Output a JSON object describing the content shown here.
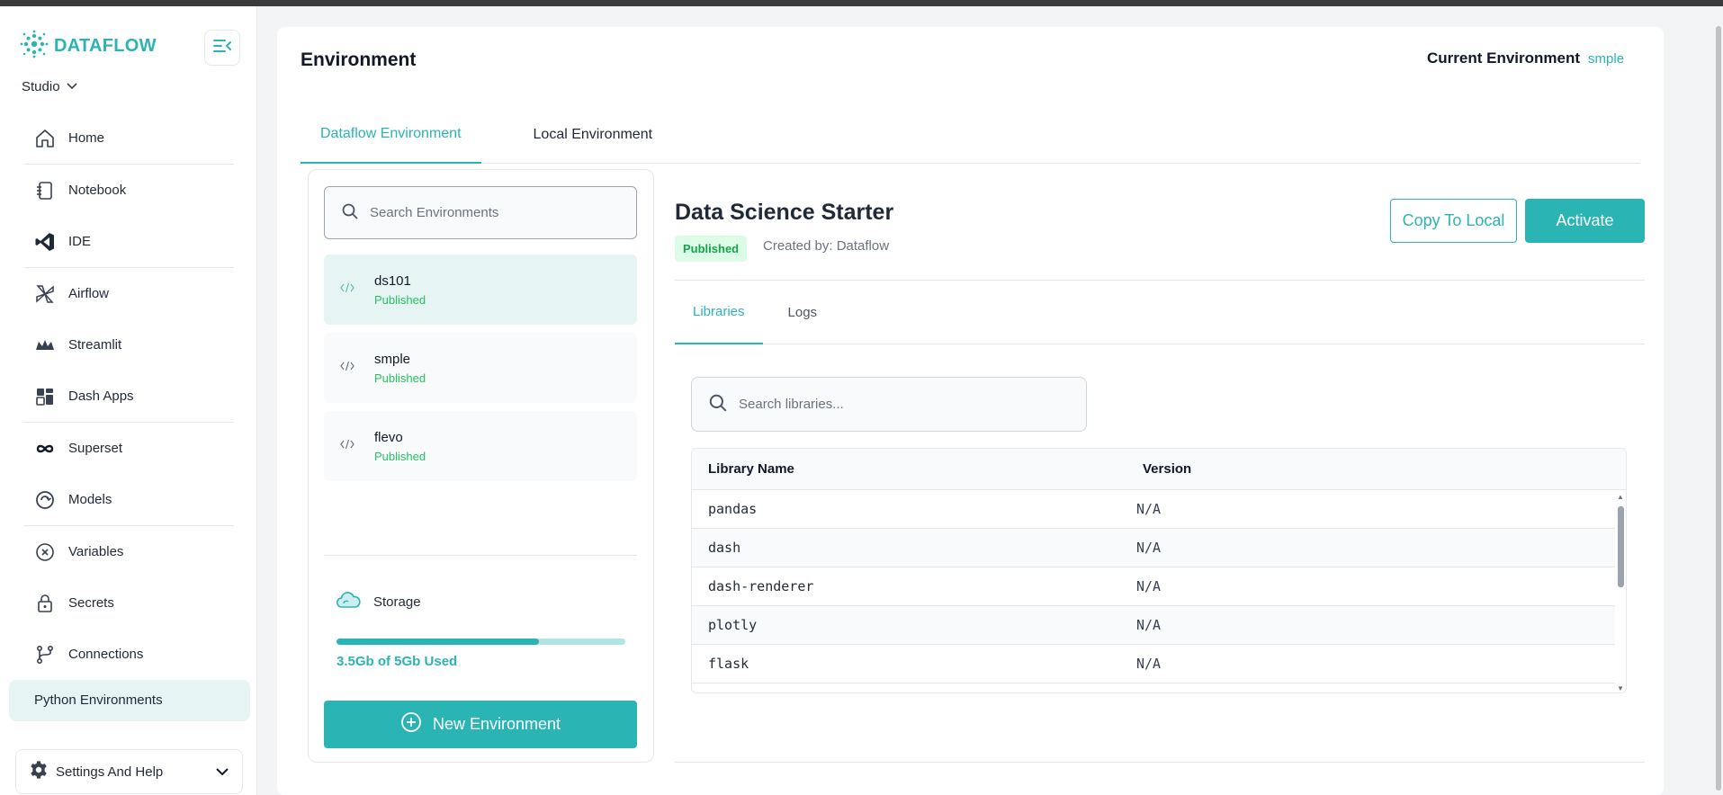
{
  "app": {
    "logo_text": "DATAFLOW",
    "workspace": "Studio"
  },
  "sidebar": {
    "items": [
      {
        "label": "Home",
        "icon": "home-icon"
      },
      {
        "label": "Notebook",
        "icon": "notebook-icon"
      },
      {
        "label": "IDE",
        "icon": "vscode-icon"
      },
      {
        "label": "Airflow",
        "icon": "airflow-icon"
      },
      {
        "label": "Streamlit",
        "icon": "streamlit-icon"
      },
      {
        "label": "Dash Apps",
        "icon": "dash-apps-icon"
      },
      {
        "label": "Superset",
        "icon": "infinity-icon"
      },
      {
        "label": "Models",
        "icon": "models-icon"
      },
      {
        "label": "Variables",
        "icon": "variables-icon"
      },
      {
        "label": "Secrets",
        "icon": "lock-icon"
      },
      {
        "label": "Connections",
        "icon": "connections-icon"
      },
      {
        "label": "Python Environments",
        "icon": "code-icon"
      }
    ],
    "settings_label": "Settings And Help"
  },
  "header": {
    "title": "Environment",
    "current_env_label": "Current Environment",
    "current_env_value": "smple"
  },
  "env_tabs": [
    {
      "label": "Dataflow Environment",
      "active": true
    },
    {
      "label": "Local Environment",
      "active": false
    }
  ],
  "env_panel": {
    "search_placeholder": "Search Environments",
    "environments": [
      {
        "name": "ds101",
        "status": "Published",
        "selected": true
      },
      {
        "name": "smple",
        "status": "Published",
        "selected": false
      },
      {
        "name": "flevo",
        "status": "Published",
        "selected": false
      }
    ],
    "storage_label": "Storage",
    "storage_used_text": "3.5Gb of 5Gb Used",
    "storage_fraction": 0.7,
    "new_env_label": "New Environment"
  },
  "detail": {
    "title": "Data Science Starter",
    "badge": "Published",
    "created_by": "Created by: Dataflow",
    "copy_label": "Copy To Local",
    "activate_label": "Activate",
    "tabs": [
      {
        "label": "Libraries",
        "active": true
      },
      {
        "label": "Logs",
        "active": false
      }
    ],
    "search_placeholder": "Search libraries...",
    "table_headers": [
      "Library Name",
      "Version"
    ],
    "libraries": [
      {
        "name": "pandas",
        "version": "N/A"
      },
      {
        "name": "dash",
        "version": "N/A"
      },
      {
        "name": "dash-renderer",
        "version": "N/A"
      },
      {
        "name": "plotly",
        "version": "N/A"
      },
      {
        "name": "flask",
        "version": "N/A"
      }
    ]
  },
  "colors": {
    "accent": "#2bb4b4",
    "success": "#22c55e"
  }
}
